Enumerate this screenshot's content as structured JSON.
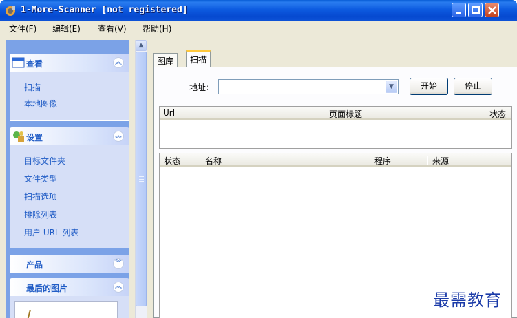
{
  "window": {
    "title": "1-More-Scanner [not registered]"
  },
  "menu": [
    "文件(F)",
    "编辑(E)",
    "查看(V)",
    "帮助(H)"
  ],
  "left_panel": {
    "groups": [
      {
        "title": "查看",
        "items": [
          "扫描",
          "本地图像"
        ]
      },
      {
        "title": "设置",
        "items": [
          "目标文件夹",
          "文件类型",
          "扫描选项",
          "排除列表",
          "用户 URL 列表"
        ]
      },
      {
        "title": "产品",
        "items": []
      },
      {
        "title": "最后的图片",
        "items": []
      }
    ]
  },
  "tabs": [
    "图库",
    "扫描"
  ],
  "scan": {
    "address_label": "地址:",
    "address_value": "",
    "start_button": "开始",
    "stop_button": "停止"
  },
  "url_list": {
    "columns": [
      "Url",
      "页面标题",
      "状态"
    ]
  },
  "result_list": {
    "columns": [
      "状态",
      "名称",
      "程序",
      "来源"
    ]
  },
  "watermark": "最需教育"
}
